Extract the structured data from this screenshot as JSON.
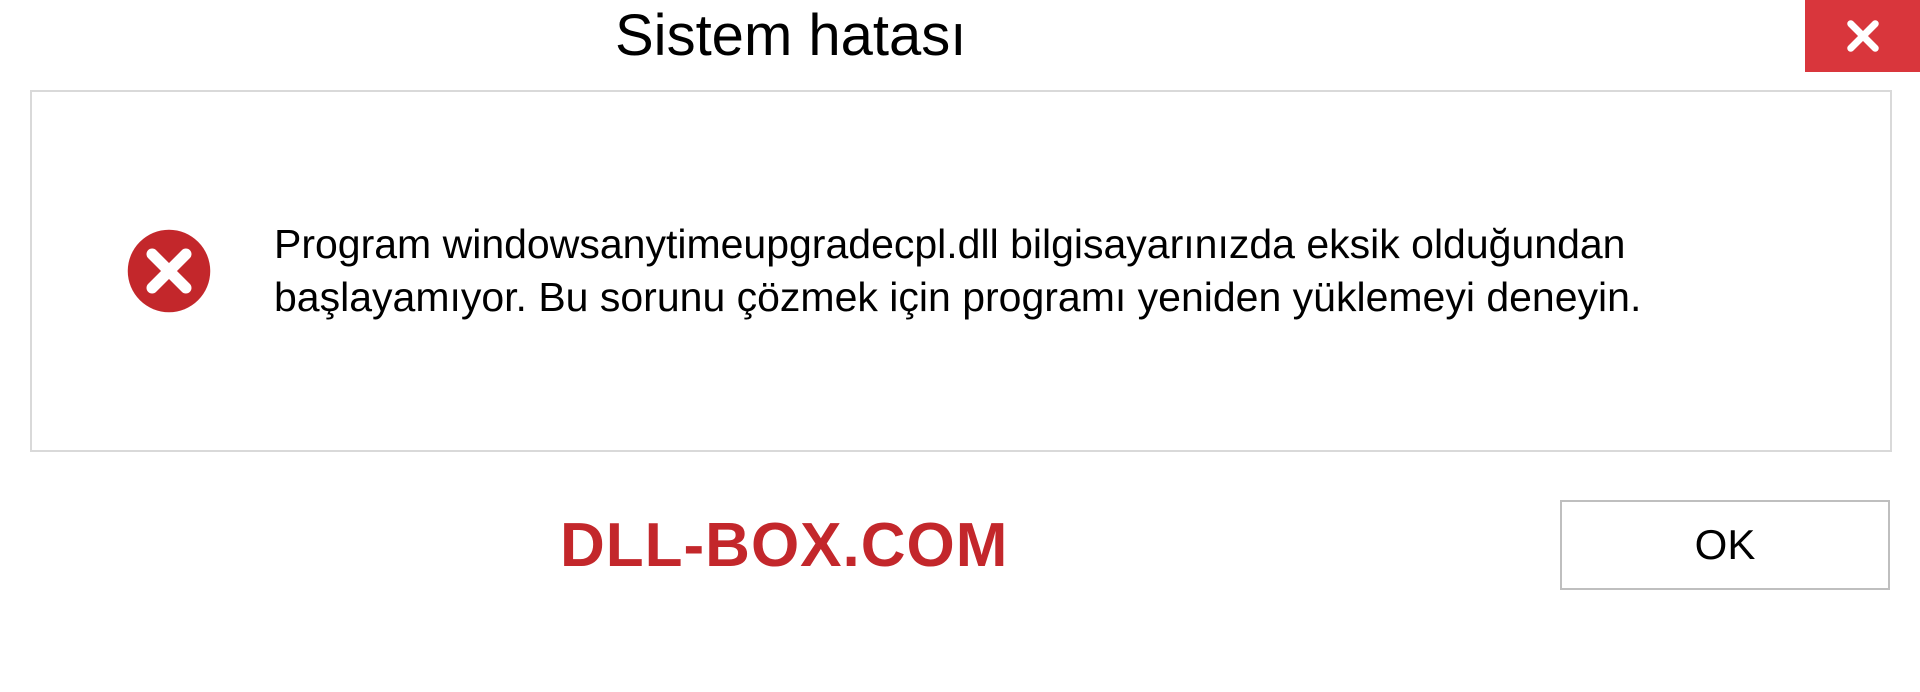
{
  "dialog": {
    "title": "Sistem hatası",
    "message": "Program windowsanytimeupgradecpl.dll bilgisayarınızda eksik olduğundan başlayamıyor. Bu sorunu çözmek için programı yeniden yüklemeyi deneyin.",
    "ok_label": "OK"
  },
  "watermark": "DLL-BOX.COM"
}
